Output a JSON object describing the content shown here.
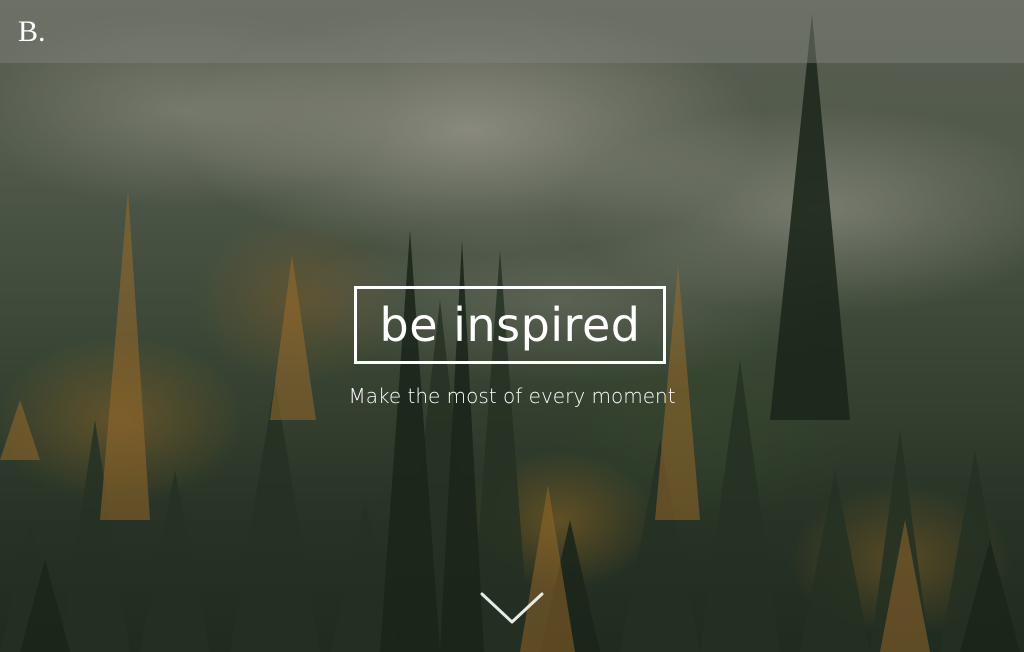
{
  "header": {
    "logo_text": "B."
  },
  "hero": {
    "headline": "be inspired",
    "subtitle": "Make the most of every moment",
    "scroll_icon": "chevron-down-icon"
  },
  "colors": {
    "text": "#ffffff",
    "topbar_overlay": "rgba(130,132,124,0.45)"
  }
}
